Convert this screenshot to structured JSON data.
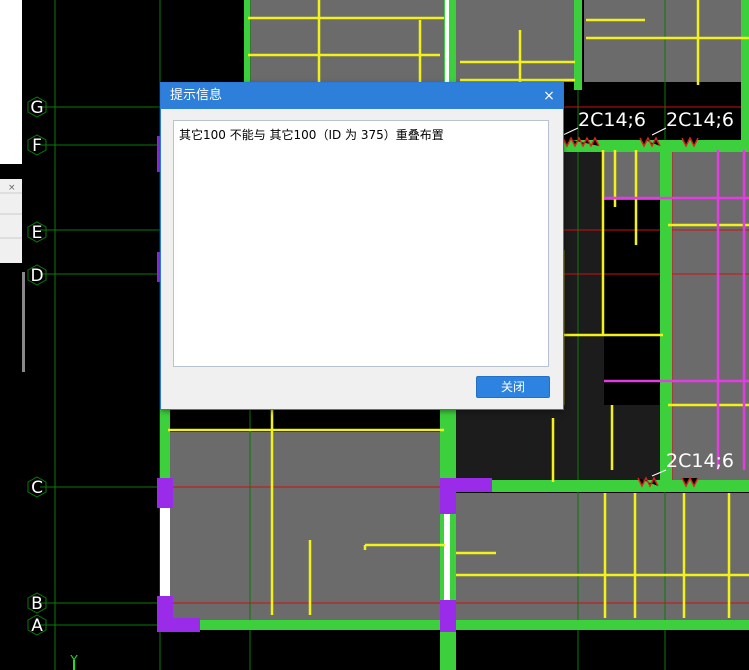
{
  "cad": {
    "axis_labels_left": [
      "G",
      "F",
      "E",
      "D",
      "C",
      "B",
      "A"
    ],
    "axis_label_y": "Y",
    "rebar_labels": [
      "2C14;6",
      "2C14;6",
      "2C14;6"
    ]
  },
  "dialog": {
    "title": "提示信息",
    "close_symbol": "×",
    "message": "其它100 不能与 其它100（ID 为 375）重叠布置",
    "ok_label": "关闭"
  },
  "colors": {
    "background": "#000000",
    "grid_green": "#0a7a0a",
    "axis_red": "#cc1111",
    "slab_gray": "#6b6b6b",
    "beam_green": "#3cd03c",
    "rebar_yellow": "#f2f218",
    "rebar_magenta": "#e23ce2",
    "column_purple": "#9a2be8",
    "dialog_title_blue": "#2e7fd9"
  }
}
